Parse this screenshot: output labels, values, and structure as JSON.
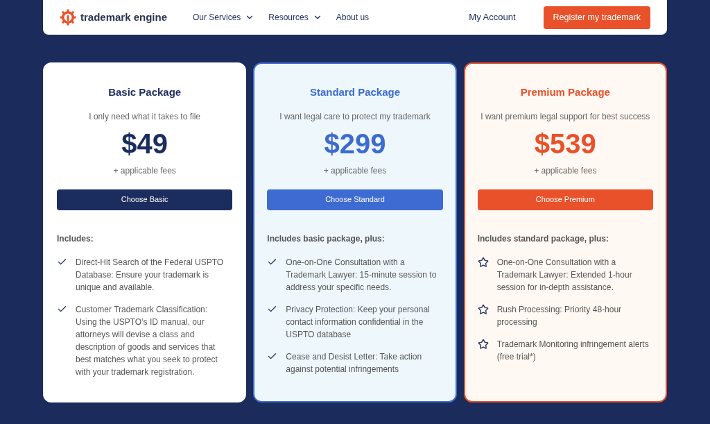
{
  "header": {
    "logo": "trademark engine",
    "nav": [
      {
        "label": "Our Services",
        "dropdown": true
      },
      {
        "label": "Resources",
        "dropdown": true
      },
      {
        "label": "About us",
        "dropdown": false
      }
    ],
    "account": "My Account",
    "cta": "Register my trademark"
  },
  "plans": [
    {
      "kind": "basic",
      "color": "#1b2d5e",
      "title": "Basic Package",
      "tagline": "I only need what it takes to file",
      "price": "$49",
      "fees": "+ applicable fees",
      "button": "Choose Basic",
      "includes": "Includes:",
      "features": [
        {
          "kind": "check",
          "text": "Direct-Hit Search of the Federal USPTO Database: Ensure your trademark is unique and available."
        },
        {
          "kind": "check",
          "text": "Customer Trademark Classification: Using the USPTO’s ID manual, our attorneys will devise a class and description of goods and services that best matches what you seek to protect with your trademark registration."
        }
      ]
    },
    {
      "kind": "standard",
      "color": "#3d6bd1",
      "title": "Standard Package",
      "tagline": "I want legal care to protect my trademark",
      "price": "$299",
      "fees": "+ applicable fees",
      "button": "Choose Standard",
      "includes": "Includes basic package, plus:",
      "features": [
        {
          "kind": "check",
          "text": "One-on-One Consultation with a Trademark Lawyer: 15-minute session to address your specific needs."
        },
        {
          "kind": "check",
          "text": "Privacy Protection: Keep your personal contact information confidential in the USPTO database"
        },
        {
          "kind": "check",
          "text": "Cease and Desist Letter: Take action against potential infringements"
        }
      ]
    },
    {
      "kind": "premium",
      "color": "#e8512a",
      "title": "Premium Package",
      "tagline": "I want premium legal support for best success",
      "price": "$539",
      "fees": "+ applicable fees",
      "button": "Choose Premium",
      "includes": "Includes standard package, plus:",
      "features": [
        {
          "kind": "star",
          "text": "One-on-One Consultation with a Trademark Lawyer: Extended 1-hour session for in-depth assistance."
        },
        {
          "kind": "star",
          "text": "Rush Processing: Priority 48-hour processing"
        },
        {
          "kind": "star",
          "text": "Trademark Monitoring infringement alerts (free trial*)"
        }
      ]
    }
  ]
}
